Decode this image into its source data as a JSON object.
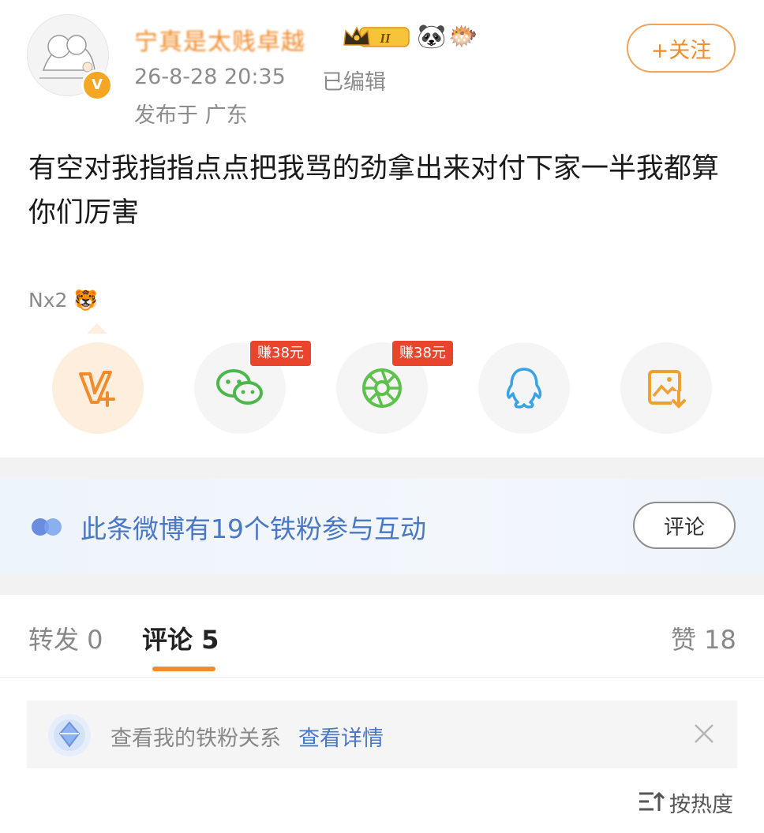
{
  "post": {
    "username": "宁真是太贱卓越",
    "verified_badge": "V",
    "level_badge": "II",
    "emojis": [
      "🐼",
      "🐡"
    ],
    "time": "26-8-28 20:35",
    "edited": "已编辑",
    "location": "发布于 广东",
    "follow_label": "+关注",
    "text": "有空对我指指点点把我骂的劲拿出来对付下家一半我都算你们厉害",
    "tag": "Nx2",
    "tag_emoji": "🐯"
  },
  "share": {
    "items": [
      {
        "icon": "v-plus-icon"
      },
      {
        "icon": "wechat-icon",
        "badge": "赚38元"
      },
      {
        "icon": "moments-icon",
        "badge": "赚38元"
      },
      {
        "icon": "qq-icon"
      },
      {
        "icon": "save-image-icon"
      }
    ]
  },
  "fans_banner": {
    "text": "此条微博有19个铁粉参与互动",
    "button": "评论"
  },
  "tabs": {
    "repost": "转发 0",
    "comments": "评论 5",
    "likes": "赞 18"
  },
  "relation": {
    "text": "查看我的铁粉关系",
    "link": "查看详情"
  },
  "sort": {
    "label": "按热度"
  },
  "colors": {
    "accent": "#f08c2c",
    "link_blue": "#4a78c4",
    "badge_red": "#e8452c",
    "wechat_green": "#4cb84c"
  }
}
